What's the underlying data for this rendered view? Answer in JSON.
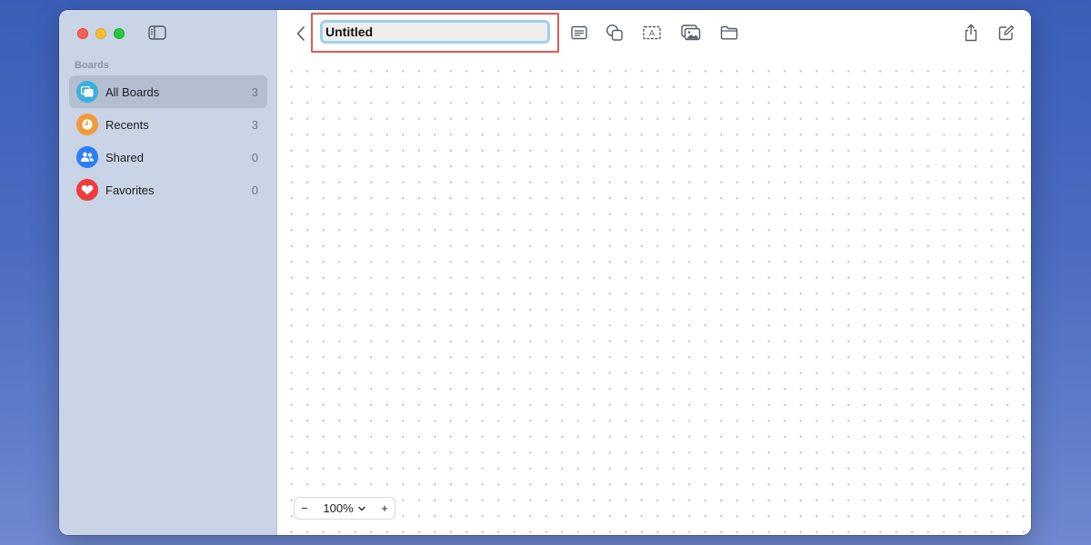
{
  "sidebar": {
    "section_title": "Boards",
    "items": [
      {
        "label": "All Boards",
        "count": "3",
        "icon": "all-boards-icon",
        "color": "#3bb0e0"
      },
      {
        "label": "Recents",
        "count": "3",
        "icon": "clock-icon",
        "color": "#f29a3a"
      },
      {
        "label": "Shared",
        "count": "0",
        "icon": "people-icon",
        "color": "#2f7ef5"
      },
      {
        "label": "Favorites",
        "count": "0",
        "icon": "heart-icon",
        "color": "#ee3b3b"
      }
    ]
  },
  "toolbar": {
    "title_value": "Untitled",
    "icons": [
      "sticky-note-icon",
      "shapes-icon",
      "text-box-icon",
      "media-icon",
      "folder-icon",
      "share-icon",
      "compose-icon"
    ]
  },
  "zoom": {
    "minus": "−",
    "value": "100%",
    "plus": "+"
  }
}
